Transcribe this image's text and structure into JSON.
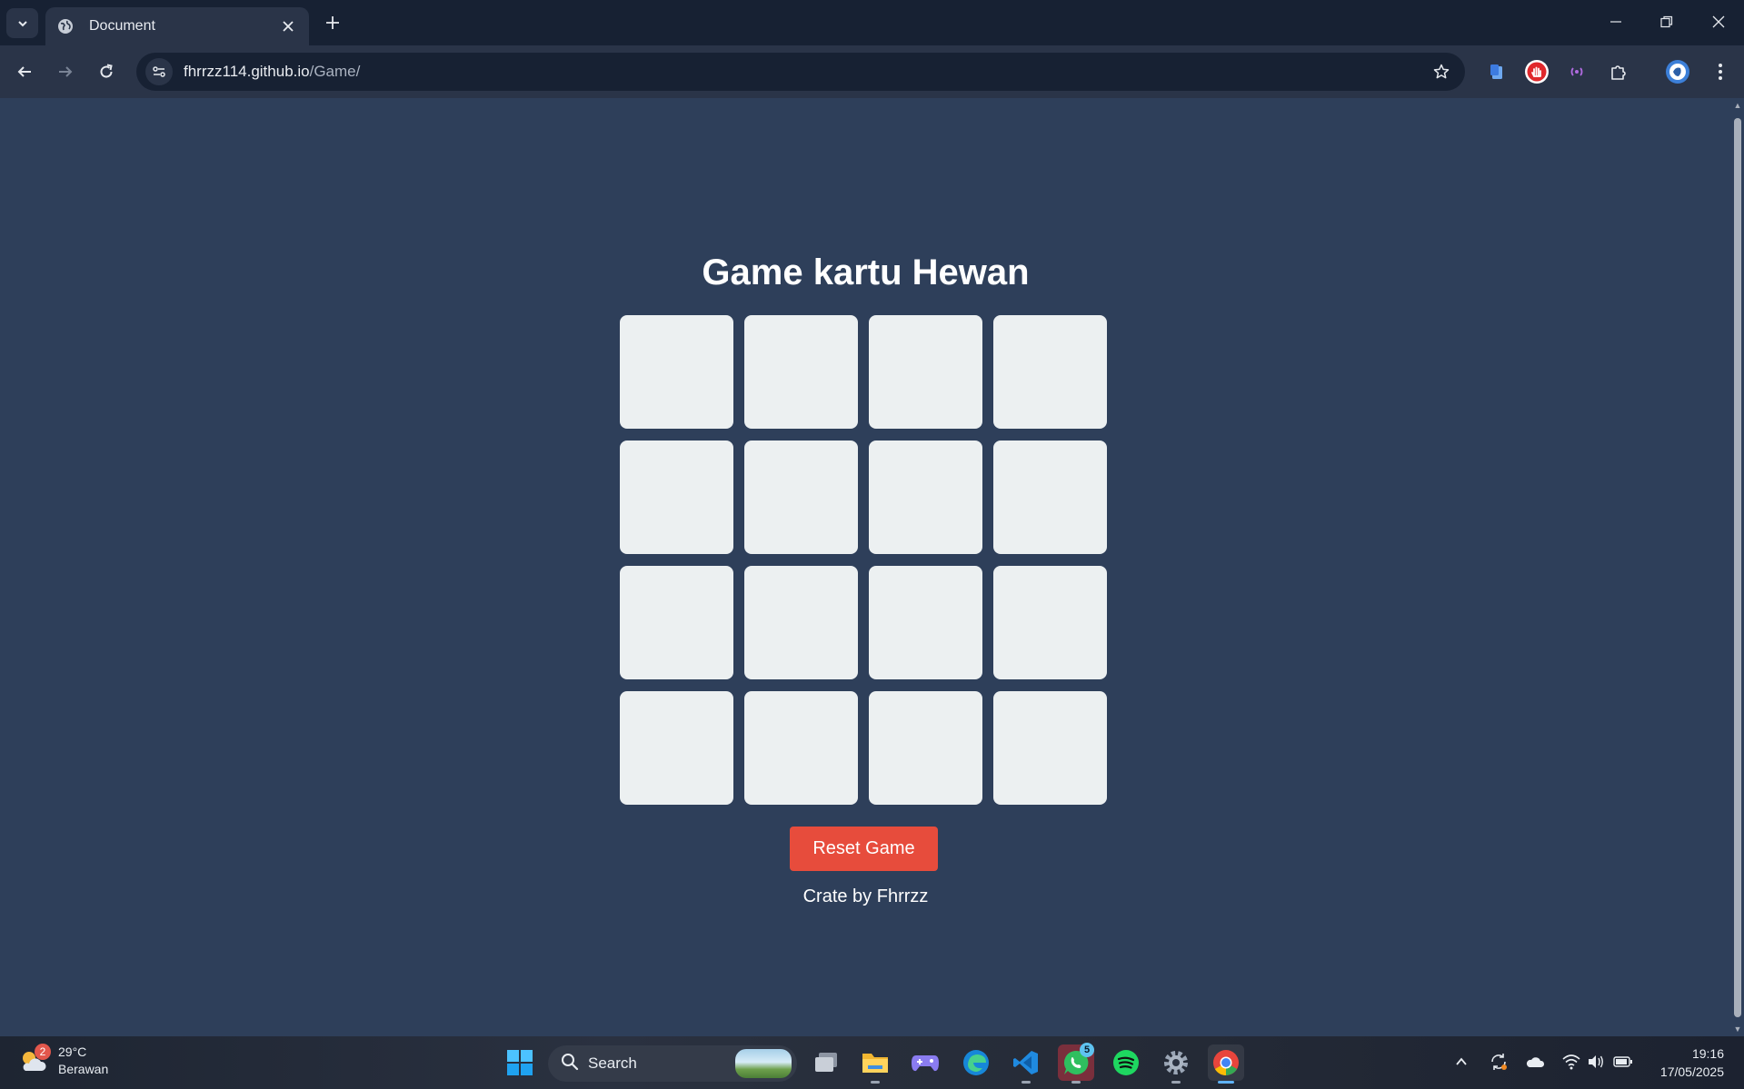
{
  "browser": {
    "tab_title": "Document",
    "url_host": "fhrrzz114.github.io",
    "url_path": "/Game/"
  },
  "page": {
    "title": "Game kartu Hewan",
    "cards": [
      "",
      "",
      "",
      "",
      "",
      "",
      "",
      "",
      "",
      "",
      "",
      "",
      "",
      "",
      "",
      ""
    ],
    "reset_label": "Reset Game",
    "credit": "Crate by Fhrrzz",
    "background_color": "#2e3f5a",
    "card_color": "#ecf0f1",
    "button_color": "#e74c3c"
  },
  "taskbar": {
    "weather_badge": "2",
    "temperature": "29°C",
    "weather_desc": "Berawan",
    "search_label": "Search",
    "whatsapp_badge": "5",
    "time": "19:16",
    "date": "17/05/2025"
  }
}
